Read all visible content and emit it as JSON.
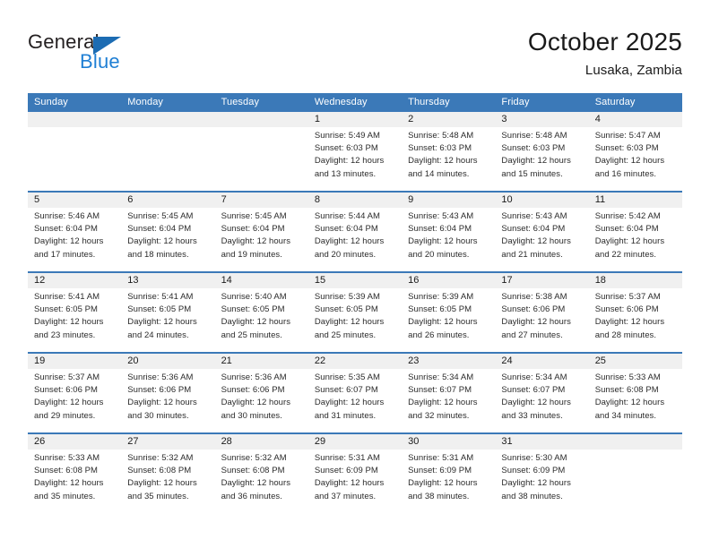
{
  "brand": {
    "name_top": "General",
    "name_bottom": "Blue",
    "triangle_icon": "blue-triangle-icon",
    "colors": {
      "dark": "#231f20",
      "blue": "#1f7fd4",
      "triangle": "#1c6cb3"
    }
  },
  "header": {
    "title": "October 2025",
    "subtitle": "Lusaka, Zambia"
  },
  "theme": {
    "header_blue": "#3b79b8",
    "day_band_gray": "#f0f0f0",
    "text": "#2b2b2b"
  },
  "calendar": {
    "weekdays": [
      "Sunday",
      "Monday",
      "Tuesday",
      "Wednesday",
      "Thursday",
      "Friday",
      "Saturday"
    ],
    "weeks": [
      [
        {
          "day": "",
          "lines": []
        },
        {
          "day": "",
          "lines": []
        },
        {
          "day": "",
          "lines": []
        },
        {
          "day": "1",
          "lines": [
            "Sunrise: 5:49 AM",
            "Sunset: 6:03 PM",
            "Daylight: 12 hours",
            "and 13 minutes."
          ]
        },
        {
          "day": "2",
          "lines": [
            "Sunrise: 5:48 AM",
            "Sunset: 6:03 PM",
            "Daylight: 12 hours",
            "and 14 minutes."
          ]
        },
        {
          "day": "3",
          "lines": [
            "Sunrise: 5:48 AM",
            "Sunset: 6:03 PM",
            "Daylight: 12 hours",
            "and 15 minutes."
          ]
        },
        {
          "day": "4",
          "lines": [
            "Sunrise: 5:47 AM",
            "Sunset: 6:03 PM",
            "Daylight: 12 hours",
            "and 16 minutes."
          ]
        }
      ],
      [
        {
          "day": "5",
          "lines": [
            "Sunrise: 5:46 AM",
            "Sunset: 6:04 PM",
            "Daylight: 12 hours",
            "and 17 minutes."
          ]
        },
        {
          "day": "6",
          "lines": [
            "Sunrise: 5:45 AM",
            "Sunset: 6:04 PM",
            "Daylight: 12 hours",
            "and 18 minutes."
          ]
        },
        {
          "day": "7",
          "lines": [
            "Sunrise: 5:45 AM",
            "Sunset: 6:04 PM",
            "Daylight: 12 hours",
            "and 19 minutes."
          ]
        },
        {
          "day": "8",
          "lines": [
            "Sunrise: 5:44 AM",
            "Sunset: 6:04 PM",
            "Daylight: 12 hours",
            "and 20 minutes."
          ]
        },
        {
          "day": "9",
          "lines": [
            "Sunrise: 5:43 AM",
            "Sunset: 6:04 PM",
            "Daylight: 12 hours",
            "and 20 minutes."
          ]
        },
        {
          "day": "10",
          "lines": [
            "Sunrise: 5:43 AM",
            "Sunset: 6:04 PM",
            "Daylight: 12 hours",
            "and 21 minutes."
          ]
        },
        {
          "day": "11",
          "lines": [
            "Sunrise: 5:42 AM",
            "Sunset: 6:04 PM",
            "Daylight: 12 hours",
            "and 22 minutes."
          ]
        }
      ],
      [
        {
          "day": "12",
          "lines": [
            "Sunrise: 5:41 AM",
            "Sunset: 6:05 PM",
            "Daylight: 12 hours",
            "and 23 minutes."
          ]
        },
        {
          "day": "13",
          "lines": [
            "Sunrise: 5:41 AM",
            "Sunset: 6:05 PM",
            "Daylight: 12 hours",
            "and 24 minutes."
          ]
        },
        {
          "day": "14",
          "lines": [
            "Sunrise: 5:40 AM",
            "Sunset: 6:05 PM",
            "Daylight: 12 hours",
            "and 25 minutes."
          ]
        },
        {
          "day": "15",
          "lines": [
            "Sunrise: 5:39 AM",
            "Sunset: 6:05 PM",
            "Daylight: 12 hours",
            "and 25 minutes."
          ]
        },
        {
          "day": "16",
          "lines": [
            "Sunrise: 5:39 AM",
            "Sunset: 6:05 PM",
            "Daylight: 12 hours",
            "and 26 minutes."
          ]
        },
        {
          "day": "17",
          "lines": [
            "Sunrise: 5:38 AM",
            "Sunset: 6:06 PM",
            "Daylight: 12 hours",
            "and 27 minutes."
          ]
        },
        {
          "day": "18",
          "lines": [
            "Sunrise: 5:37 AM",
            "Sunset: 6:06 PM",
            "Daylight: 12 hours",
            "and 28 minutes."
          ]
        }
      ],
      [
        {
          "day": "19",
          "lines": [
            "Sunrise: 5:37 AM",
            "Sunset: 6:06 PM",
            "Daylight: 12 hours",
            "and 29 minutes."
          ]
        },
        {
          "day": "20",
          "lines": [
            "Sunrise: 5:36 AM",
            "Sunset: 6:06 PM",
            "Daylight: 12 hours",
            "and 30 minutes."
          ]
        },
        {
          "day": "21",
          "lines": [
            "Sunrise: 5:36 AM",
            "Sunset: 6:06 PM",
            "Daylight: 12 hours",
            "and 30 minutes."
          ]
        },
        {
          "day": "22",
          "lines": [
            "Sunrise: 5:35 AM",
            "Sunset: 6:07 PM",
            "Daylight: 12 hours",
            "and 31 minutes."
          ]
        },
        {
          "day": "23",
          "lines": [
            "Sunrise: 5:34 AM",
            "Sunset: 6:07 PM",
            "Daylight: 12 hours",
            "and 32 minutes."
          ]
        },
        {
          "day": "24",
          "lines": [
            "Sunrise: 5:34 AM",
            "Sunset: 6:07 PM",
            "Daylight: 12 hours",
            "and 33 minutes."
          ]
        },
        {
          "day": "25",
          "lines": [
            "Sunrise: 5:33 AM",
            "Sunset: 6:08 PM",
            "Daylight: 12 hours",
            "and 34 minutes."
          ]
        }
      ],
      [
        {
          "day": "26",
          "lines": [
            "Sunrise: 5:33 AM",
            "Sunset: 6:08 PM",
            "Daylight: 12 hours",
            "and 35 minutes."
          ]
        },
        {
          "day": "27",
          "lines": [
            "Sunrise: 5:32 AM",
            "Sunset: 6:08 PM",
            "Daylight: 12 hours",
            "and 35 minutes."
          ]
        },
        {
          "day": "28",
          "lines": [
            "Sunrise: 5:32 AM",
            "Sunset: 6:08 PM",
            "Daylight: 12 hours",
            "and 36 minutes."
          ]
        },
        {
          "day": "29",
          "lines": [
            "Sunrise: 5:31 AM",
            "Sunset: 6:09 PM",
            "Daylight: 12 hours",
            "and 37 minutes."
          ]
        },
        {
          "day": "30",
          "lines": [
            "Sunrise: 5:31 AM",
            "Sunset: 6:09 PM",
            "Daylight: 12 hours",
            "and 38 minutes."
          ]
        },
        {
          "day": "31",
          "lines": [
            "Sunrise: 5:30 AM",
            "Sunset: 6:09 PM",
            "Daylight: 12 hours",
            "and 38 minutes."
          ]
        },
        {
          "day": "",
          "lines": []
        }
      ]
    ]
  }
}
